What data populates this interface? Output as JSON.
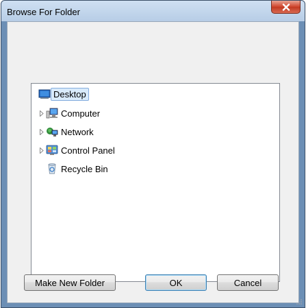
{
  "window": {
    "title": "Browse For Folder"
  },
  "tree": {
    "items": [
      {
        "label": "Desktop",
        "icon": "desktop-icon",
        "expandable": false,
        "selected": true
      },
      {
        "label": "Computer",
        "icon": "computer-icon",
        "expandable": true,
        "selected": false
      },
      {
        "label": "Network",
        "icon": "network-icon",
        "expandable": true,
        "selected": false
      },
      {
        "label": "Control Panel",
        "icon": "control-panel-icon",
        "expandable": true,
        "selected": false
      },
      {
        "label": "Recycle Bin",
        "icon": "recycle-bin-icon",
        "expandable": false,
        "selected": false
      }
    ]
  },
  "buttons": {
    "make_new_folder": "Make New Folder",
    "ok": "OK",
    "cancel": "Cancel"
  },
  "colors": {
    "title_bar": "#c4d7ed",
    "close_button": "#c94730",
    "selection": "#d9ebfb",
    "dialog_face": "#f0f0f0"
  }
}
